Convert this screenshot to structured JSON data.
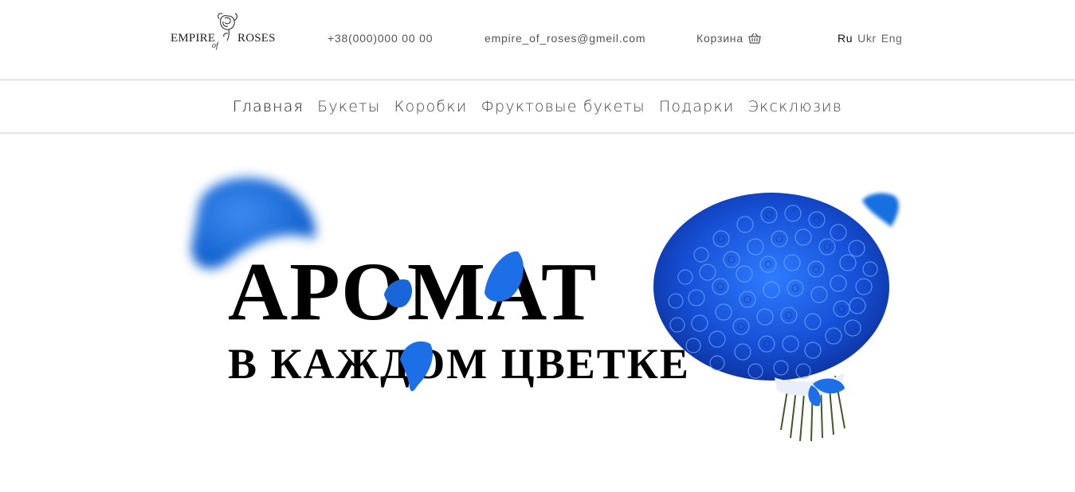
{
  "header": {
    "logo": {
      "left": "EMPIRE",
      "of": "of",
      "right": "ROSES"
    },
    "phone": "+38(000)000 00 00",
    "email": "empire_of_roses@gmeil.com",
    "cart": {
      "label": "Корзина",
      "icon": "basket-icon"
    },
    "languages": [
      {
        "label": "Ru",
        "active": true
      },
      {
        "label": "Ukr",
        "active": false
      },
      {
        "label": "Eng",
        "active": false
      }
    ]
  },
  "nav": {
    "items": [
      {
        "label": "Главная",
        "active": true
      },
      {
        "label": "Букеты"
      },
      {
        "label": "Коробки"
      },
      {
        "label": "Фруктовые букеты"
      },
      {
        "label": "Подарки"
      },
      {
        "label": "Эксклюзив"
      }
    ]
  },
  "hero": {
    "title": "АРОМАТ",
    "subtitle": "В КАЖДОМ ЦВЕТКЕ",
    "image": "blue-roses-bouquet",
    "accent_color": "#1565d8"
  }
}
